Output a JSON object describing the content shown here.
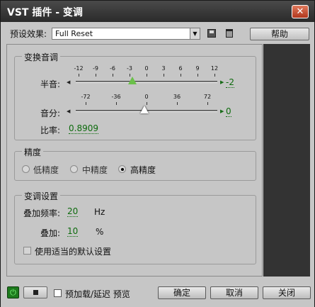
{
  "window": {
    "title": "VST 插件 - 变调",
    "close_glyph": "✕"
  },
  "toolbar": {
    "preset_label": "预设效果:",
    "preset_value": "Full Reset",
    "dropdown_glyph": "▼",
    "help_label": "帮助"
  },
  "pitch_shift": {
    "group_title": "变换音调",
    "semitone": {
      "label": "半音:",
      "value": "-2",
      "ticks": [
        "-12",
        "-9",
        "-6",
        "-3",
        "0",
        "3",
        "6",
        "9",
        "12"
      ]
    },
    "cents": {
      "label": "音分:",
      "value": "0",
      "ticks": [
        "-72",
        "-36",
        "0",
        "36",
        "72"
      ]
    },
    "ratio": {
      "label": "比率:",
      "value": "0.8909"
    }
  },
  "precision": {
    "group_title": "精度",
    "options": [
      {
        "label": "低精度",
        "selected": false
      },
      {
        "label": "中精度",
        "selected": false
      },
      {
        "label": "高精度",
        "selected": true
      }
    ]
  },
  "pitch_settings": {
    "group_title": "变调设置",
    "splice_freq": {
      "label": "叠加频率:",
      "value": "20",
      "unit": "Hz"
    },
    "overlap": {
      "label": "叠加:",
      "value": "10",
      "unit": "%"
    },
    "default_settings_label": "使用适当的默认设置"
  },
  "bottom": {
    "power_glyph": "⏻",
    "preload_label": "预加载/延迟 预览",
    "ok_label": "确定",
    "cancel_label": "取消",
    "close_label": "关闭"
  }
}
